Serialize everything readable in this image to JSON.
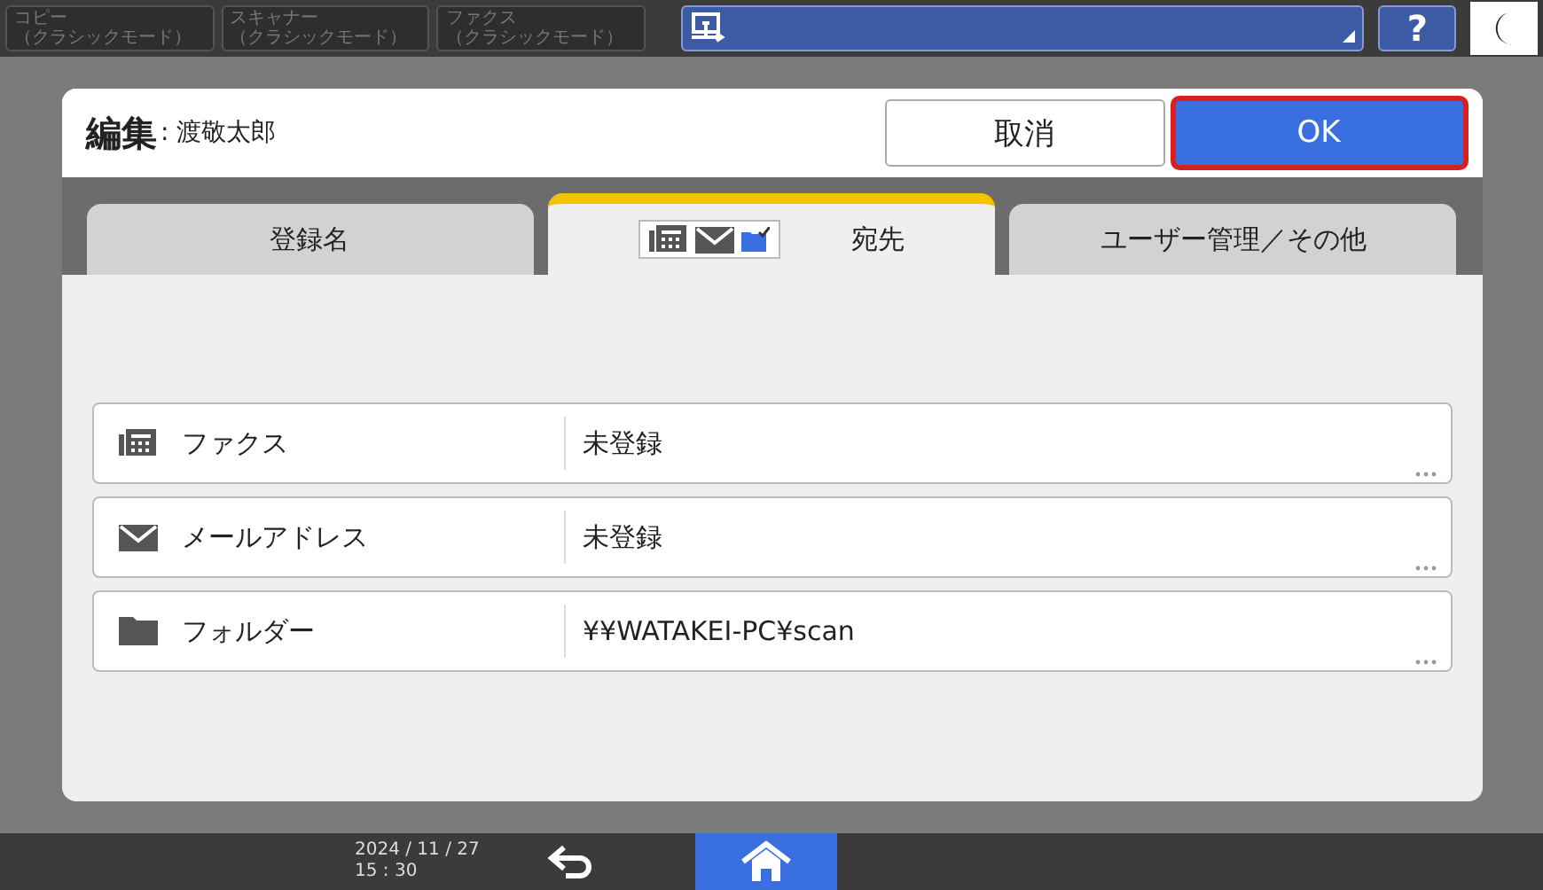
{
  "top_bar": {
    "modes": [
      {
        "line1": "コピー",
        "line2": "（クラシックモード）"
      },
      {
        "line1": "スキャナー",
        "line2": "（クラシックモード）"
      },
      {
        "line1": "ファクス",
        "line2": "（クラシックモード）"
      }
    ],
    "help": "?"
  },
  "dialog": {
    "title": "編集",
    "subtitle": ": 渡敬太郎",
    "buttons": [
      {
        "label": "取消",
        "kind": "cancel",
        "focused": false
      },
      {
        "label": "OK",
        "kind": "ok",
        "focused": true
      }
    ],
    "tabs": [
      {
        "label": "登録名",
        "selected": false,
        "icons": false
      },
      {
        "label": "宛先",
        "selected": true,
        "icons": true
      },
      {
        "label": "ユーザー管理／その他",
        "selected": false,
        "icons": false
      }
    ],
    "rows": [
      {
        "kind": "fax",
        "label": "ファクス",
        "value": "未登録"
      },
      {
        "kind": "mail",
        "label": "メールアドレス",
        "value": "未登録"
      },
      {
        "kind": "folder",
        "label": "フォルダー",
        "value": "¥¥WATAKEI-PC¥scan"
      }
    ]
  },
  "bottom_bar": {
    "date": "2024 / 11 / 27",
    "time": "15 : 30"
  }
}
